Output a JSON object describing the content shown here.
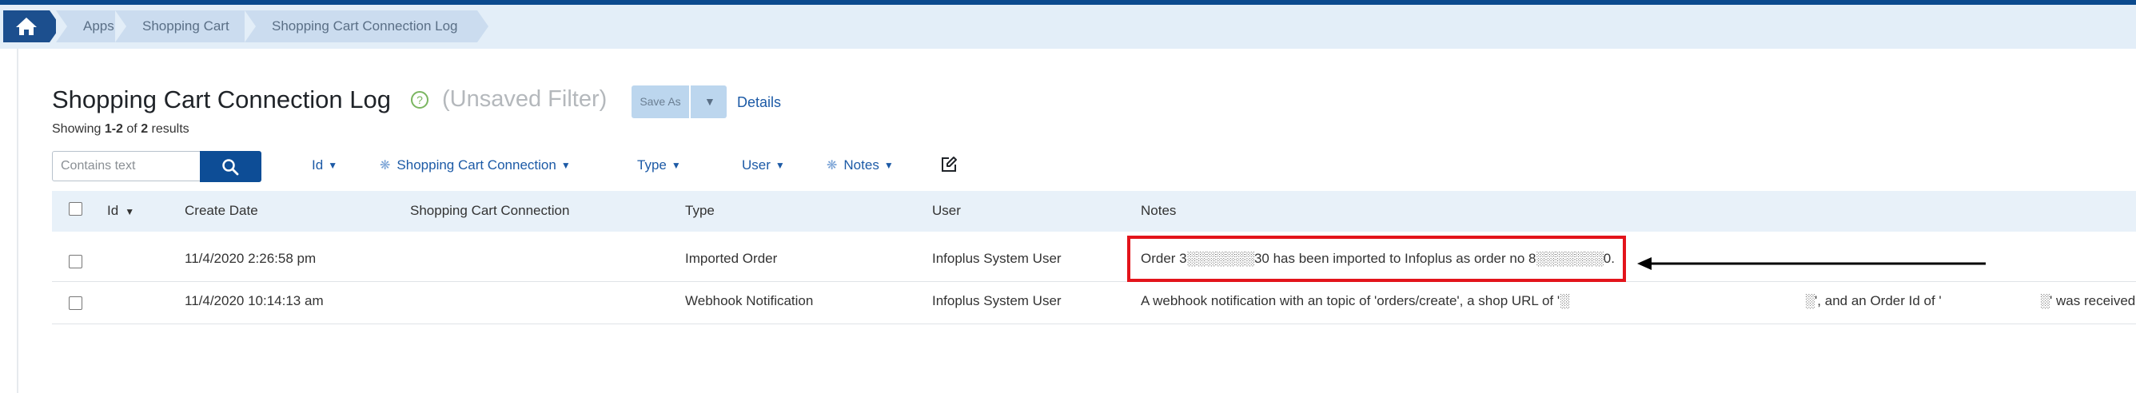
{
  "breadcrumb": {
    "home_icon": "home-icon",
    "items": [
      "Apps",
      "Shopping Cart",
      "Shopping Cart Connection Log"
    ]
  },
  "header": {
    "title": "Shopping Cart Connection Log",
    "help_glyph": "?",
    "filter_state": "(Unsaved Filter)",
    "save_as_label": "Save As",
    "details_label": "Details",
    "showing_prefix": "Showing ",
    "showing_range": "1-2",
    "showing_of": " of ",
    "showing_total": "2",
    "showing_suffix": " results"
  },
  "search": {
    "placeholder": "Contains text",
    "value": ""
  },
  "filters": [
    {
      "label": "Id",
      "starred": false
    },
    {
      "label": "Shopping Cart Connection",
      "starred": true
    },
    {
      "label": "Type",
      "starred": false
    },
    {
      "label": "User",
      "starred": false
    },
    {
      "label": "Notes",
      "starred": true
    }
  ],
  "table": {
    "columns": [
      "Id",
      "Create Date",
      "Shopping Cart Connection",
      "Type",
      "User",
      "Notes"
    ],
    "rows": [
      {
        "id": "",
        "create_date": "11/4/2020 2:26:58 pm",
        "connection": "",
        "type": "Imported Order",
        "user": "Infoplus System User",
        "notes": "Order 3░░░░░░░30 has been imported to Infoplus as order no 8░░░░░░░0."
      },
      {
        "id": "",
        "create_date": "11/4/2020 10:14:13 am",
        "connection": "",
        "type": "Webhook Notification",
        "user": "Infoplus System User",
        "notes_part1": "A webhook notification with an topic of 'orders/create', a shop URL of '░",
        "notes_part2": "░', and an Order Id of '",
        "notes_part3": "░' was received."
      }
    ]
  },
  "colors": {
    "brand_blue": "#0b4a8e",
    "link_blue": "#1c5aa6",
    "highlight_red": "#e3141b"
  }
}
